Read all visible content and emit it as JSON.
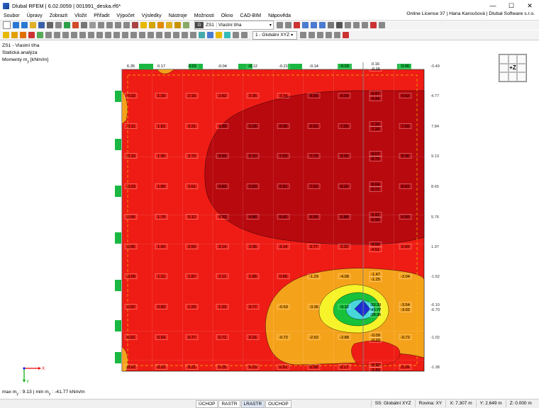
{
  "window": {
    "title": "Dlubal RFEM | 6.02.0059 | 001991_deska.rf6*",
    "minimize": "—",
    "maximize": "☐",
    "close": "✕"
  },
  "menu": [
    "Soubor",
    "Úpravy",
    "Zobrazit",
    "Vložit",
    "Přiřadit",
    "Výpočet",
    "Výsledky",
    "Nástroje",
    "Možnosti",
    "Okno",
    "CAD-BIM",
    "Nápověda"
  ],
  "license": "Online License 37 | Hana Karoušová | Dlubal Software s.r.o.",
  "load_case": {
    "color_tag": "G",
    "id": "ZS1",
    "name": "Vlastní tíha"
  },
  "view_combo": "1 - Globální XYZ",
  "info": {
    "line1": "ZS1 - Vlastní tíha",
    "line2": "Statická analýza",
    "line3": "Momenty m",
    "line3_sub": "y",
    "line3_unit": " [kNm/m]"
  },
  "navcube_label": "+Z",
  "axes": {
    "x": "X",
    "y": "Y"
  },
  "maxmin": {
    "pre": "max m",
    "sub1": "y",
    "mid": " : 9.13 | min m",
    "sub2": "y",
    "post": " : -41.77 kNm/m"
  },
  "status": {
    "buttons": [
      "ÚCHOP",
      "RASTR",
      "LRASTR",
      "OUCHOP"
    ],
    "active_button": "LRASTR",
    "ss": "SS: Globální XYZ",
    "plane": "Rovina: XY",
    "x": "X: 7.307 m",
    "y": "Y: 2.649 m",
    "z": "Z: 0.000 m"
  },
  "colors": {
    "red": "#ee1c15",
    "darkred": "#b8090f",
    "orange": "#f5a21b",
    "yellow": "#f7f32a",
    "green": "#17c23a",
    "cyan": "#47d6d9",
    "blue": "#1c2ed3"
  },
  "contour_labels": [
    "6.35",
    "0.17",
    "-0.01",
    "-0.04",
    "-0.12",
    "-0.21",
    "-0.14",
    "-0.03",
    "0.16",
    "-0.16",
    "0.06",
    "-0.49",
    "-0.02",
    "1.20",
    "2.15",
    "2.82",
    "3.35",
    "3.74",
    "4.05",
    "4.29",
    "4.47",
    "4.44",
    "4.62",
    "4.77",
    "-0.11",
    "1.81",
    "3.31",
    "4.39",
    "5.28",
    "6.05",
    "6.63",
    "7.06",
    "7.33",
    "7.34",
    "7.59",
    "7.84",
    "-0.10",
    "1.95",
    "3.70",
    "4.99",
    "6.10",
    "7.03",
    "7.79",
    "8.36",
    "8.67",
    "8.75",
    "8.96",
    "9.13",
    "-0.03",
    "1.89",
    "3.61",
    "4.89",
    "5.83",
    "6.81",
    "7.63",
    "8.26",
    "8.64",
    "8.71",
    "8.43",
    "8.65",
    "0.09",
    "1.70",
    "3.12",
    "4.12",
    "4.86",
    "5.42",
    "6.09",
    "6.88",
    "6.42",
    "6.90",
    "6.60",
    "5.76",
    "0.05",
    "1.42",
    "2.50",
    "3.14",
    "3.36",
    "3.14",
    "2.77",
    "3.32",
    "4.90",
    "4.51",
    "2.43",
    "1.97",
    "-0.05",
    "1.11",
    "1.87",
    "2.11",
    "1.85",
    "0.85",
    "-1.29",
    "-4.08",
    "-1.47",
    "-1.25",
    "-2.04",
    "-1.62",
    "0.02",
    "0.83",
    "1.29",
    "1.33",
    "0.77",
    "-0.53",
    "-3.36",
    "-9.12",
    "-23.33",
    "-41.77",
    "-28.36",
    "-3.54",
    "-3.02",
    "-6.10",
    "-6.70",
    "0.02",
    "0.54",
    "0.77",
    "0.71",
    "0.31",
    "-0.72",
    "-2.52",
    "-2.88",
    "-0.09",
    "-0.20",
    "-0.72",
    "-1.02",
    "-0.62",
    "0.22",
    "0.21",
    "0.15",
    "0.23",
    "0.01",
    "0.08",
    "0.17",
    "-5.82",
    "-5.80",
    "0.24",
    "-1.38"
  ]
}
